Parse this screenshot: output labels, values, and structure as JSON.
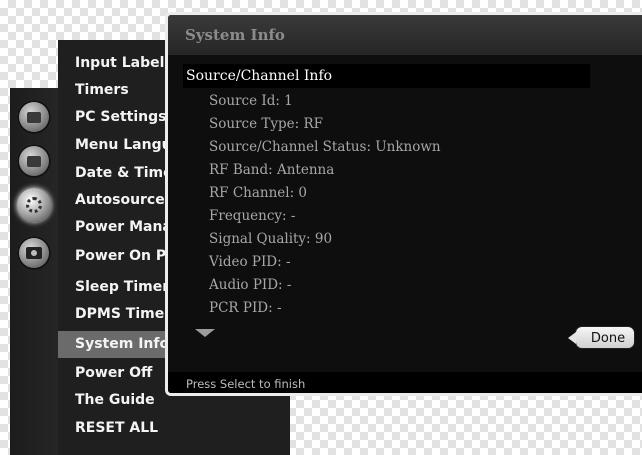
{
  "rail": {
    "icons": [
      "picture-icon",
      "tv-icon",
      "settings-gear-icon",
      "camera-icon"
    ]
  },
  "menu": {
    "items": [
      {
        "label": "Input Labels"
      },
      {
        "label": "Timers"
      },
      {
        "label": "PC Settings"
      },
      {
        "label": "Menu Language"
      },
      {
        "label": "Date & Time"
      },
      {
        "label": "Autosource"
      },
      {
        "label": "Power Management"
      },
      {
        "label": "Power On Play"
      },
      {
        "label": "Sleep Timer"
      },
      {
        "label": "DPMS Timer"
      },
      {
        "label": "System Info"
      },
      {
        "label": "Power Off"
      },
      {
        "label": "The Guide"
      },
      {
        "label": "RESET ALL"
      }
    ],
    "selected": "System Info"
  },
  "dialog": {
    "title": "System Info",
    "header": "Source/Channel Info",
    "lines": [
      "Source Id: 1",
      "Source Type: RF",
      "Source/Channel Status: Unknown",
      "RF Band: Antenna",
      "RF Channel: 0",
      "Frequency: -",
      "Signal Quality: 90",
      "Video PID: -",
      "Audio PID: -",
      "PCR PID: -"
    ],
    "done_label": "Done",
    "footer": "Press Select to finish"
  }
}
